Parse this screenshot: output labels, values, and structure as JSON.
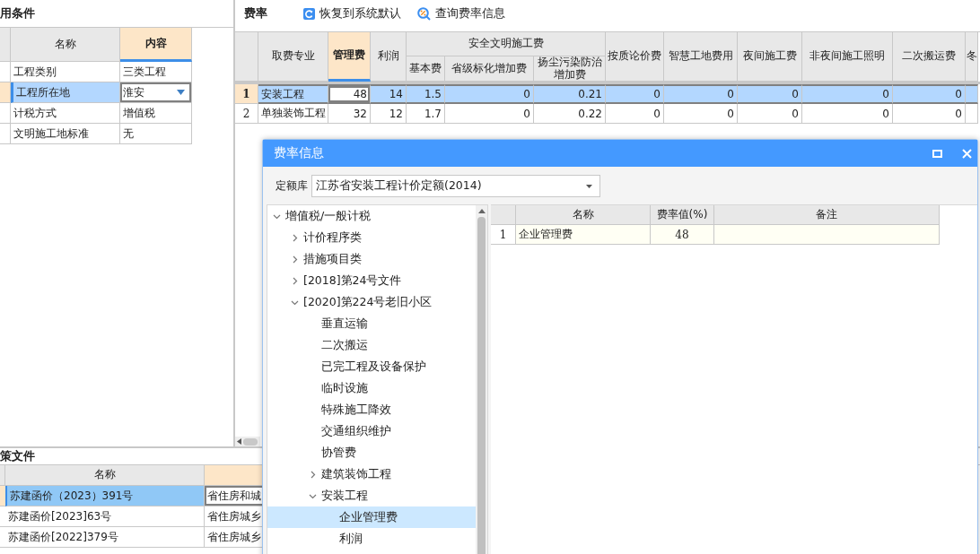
{
  "conditions": {
    "title": "用条件",
    "columns": [
      {
        "label": "名称",
        "selected": false
      },
      {
        "label": "内容",
        "selected": true
      }
    ],
    "rows": [
      {
        "name": "工程类别",
        "value": "三类工程",
        "selected": false
      },
      {
        "name": "工程所在地",
        "value": "淮安",
        "selected": true
      },
      {
        "name": "计税方式",
        "value": "增值税",
        "selected": false
      },
      {
        "name": "文明施工地标准",
        "value": "无",
        "selected": false
      }
    ]
  },
  "fee_rates": {
    "title": "费率",
    "toolbar": [
      {
        "kind": "restore",
        "label": "恢复到系统默认"
      },
      {
        "kind": "query",
        "label": "查询费率信息"
      }
    ],
    "columns": [
      {
        "label": "取费专业",
        "selected": false
      },
      {
        "label": "管理费",
        "selected": true
      },
      {
        "label": "利润",
        "selected": false
      },
      {
        "label": "基本费",
        "selected": false,
        "group": "安全文明施工费"
      },
      {
        "label": "省级标化增加费",
        "selected": false,
        "in_group": true
      },
      {
        "label": "扬尘污染防治增加费",
        "selected": false,
        "in_group": true
      },
      {
        "label": "按质论价费",
        "selected": false
      },
      {
        "label": "智慧工地费用",
        "selected": false
      },
      {
        "label": "夜间施工费",
        "selected": false
      },
      {
        "label": "非夜间施工照明",
        "selected": false
      },
      {
        "label": "二次搬运费",
        "selected": false
      },
      {
        "label": "冬",
        "selected": false
      }
    ],
    "rows": [
      {
        "number": "1",
        "selected": true,
        "cells": [
          "安装工程",
          "48",
          "14",
          "1.5",
          "0",
          "0.21",
          "0",
          "0",
          "0",
          "0",
          "0"
        ]
      },
      {
        "number": "2",
        "selected": false,
        "cells": [
          "单独装饰工程",
          "32",
          "12",
          "1.7",
          "0",
          "0.22",
          "0",
          "0",
          "0",
          "0",
          "0"
        ]
      }
    ]
  },
  "policy_files": {
    "title": "策文件",
    "columns": [
      {
        "label": "名称",
        "selected": false
      },
      {
        "selected": true
      }
    ],
    "rows": [
      {
        "name": "苏建函价（2023）391号",
        "issuer": "省住房和城",
        "selected": true
      },
      {
        "name": "苏建函价[2023]63号",
        "issuer": "省住房城乡",
        "selected": false
      },
      {
        "name": "苏建函价[2022]379号",
        "issuer": "省住房城乡",
        "selected": false
      }
    ]
  },
  "dialog": {
    "title": "费率信息",
    "library_label": "定额库",
    "library_value": "江苏省安装工程计价定额(2014)",
    "tree": [
      {
        "label": "增值税/一般计税",
        "kind": "group",
        "expanded": true,
        "selected": false,
        "children": [
          {
            "label": "计价程序类",
            "kind": "group",
            "expanded": false,
            "selected": false
          },
          {
            "label": "措施项目类",
            "kind": "group",
            "expanded": false,
            "selected": false
          },
          {
            "label": "[2018]第24号文件",
            "kind": "group",
            "expanded": false,
            "selected": false
          },
          {
            "label": "[2020]第224号老旧小区",
            "kind": "group",
            "expanded": true,
            "selected": false,
            "children": [
              {
                "label": "垂直运输",
                "kind": "leaf",
                "selected": false
              },
              {
                "label": "二次搬运",
                "kind": "leaf",
                "selected": false
              },
              {
                "label": "已完工程及设备保护",
                "kind": "leaf",
                "selected": false
              },
              {
                "label": "临时设施",
                "kind": "leaf",
                "selected": false
              },
              {
                "label": "特殊施工降效",
                "kind": "leaf",
                "selected": false
              },
              {
                "label": "交通组织维护",
                "kind": "leaf",
                "selected": false
              },
              {
                "label": "协管费",
                "kind": "leaf",
                "selected": false
              },
              {
                "label": "建筑装饰工程",
                "kind": "group",
                "expanded": false,
                "selected": false
              },
              {
                "label": "安装工程",
                "kind": "group",
                "expanded": true,
                "selected": false,
                "children": [
                  {
                    "label": "企业管理费",
                    "kind": "leaf",
                    "selected": true
                  },
                  {
                    "label": "利润",
                    "kind": "leaf",
                    "selected": false
                  }
                ]
              }
            ]
          }
        ]
      }
    ],
    "table": {
      "columns": [
        "名称",
        "费率值(%)",
        "备注"
      ],
      "rows": [
        {
          "number": "1",
          "name": "企业管理费",
          "rate": "48"
        }
      ]
    }
  }
}
